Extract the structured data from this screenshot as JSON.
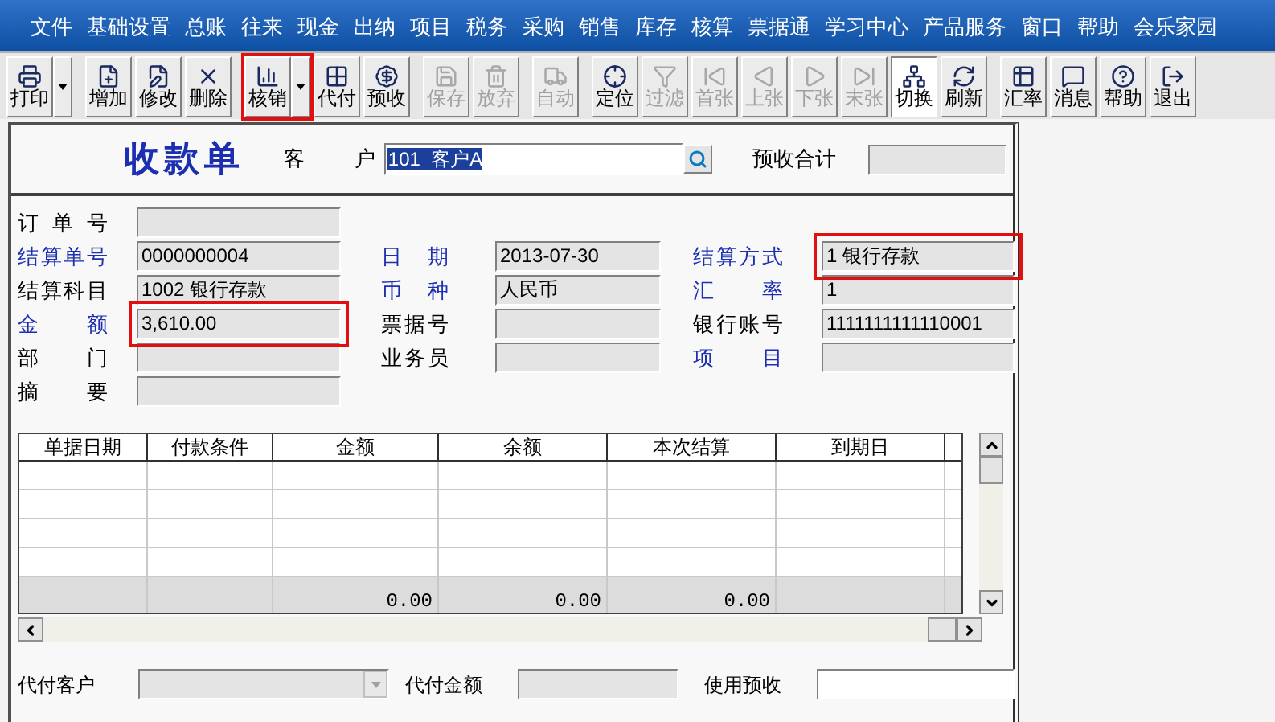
{
  "menu": [
    "文件",
    "基础设置",
    "总账",
    "往来",
    "现金",
    "出纳",
    "项目",
    "税务",
    "采购",
    "销售",
    "库存",
    "核算",
    "票据通",
    "学习中心",
    "产品服务",
    "窗口",
    "帮助",
    "会乐家园"
  ],
  "toolbar": [
    [
      {
        "label": "打印",
        "dropdown": true,
        "disabled": false,
        "pressed": false,
        "highlighted": false
      }
    ],
    [
      {
        "label": "增加",
        "dropdown": false,
        "disabled": false,
        "pressed": false,
        "highlighted": false
      },
      {
        "label": "修改",
        "dropdown": false,
        "disabled": false,
        "pressed": false,
        "highlighted": false
      },
      {
        "label": "删除",
        "dropdown": false,
        "disabled": false,
        "pressed": false,
        "highlighted": false
      }
    ],
    [
      {
        "label": "核销",
        "dropdown": true,
        "disabled": false,
        "pressed": false,
        "highlighted": true
      },
      {
        "label": "代付",
        "dropdown": false,
        "disabled": false,
        "pressed": false,
        "highlighted": false
      },
      {
        "label": "预收",
        "dropdown": false,
        "disabled": false,
        "pressed": false,
        "highlighted": false
      }
    ],
    [
      {
        "label": "保存",
        "dropdown": false,
        "disabled": true,
        "pressed": false,
        "highlighted": false
      },
      {
        "label": "放弃",
        "dropdown": false,
        "disabled": true,
        "pressed": false,
        "highlighted": false
      }
    ],
    [
      {
        "label": "自动",
        "dropdown": false,
        "disabled": true,
        "pressed": false,
        "highlighted": false
      }
    ],
    [
      {
        "label": "定位",
        "dropdown": false,
        "disabled": false,
        "pressed": false,
        "highlighted": false
      },
      {
        "label": "过滤",
        "dropdown": false,
        "disabled": true,
        "pressed": false,
        "highlighted": false
      },
      {
        "label": "首张",
        "dropdown": false,
        "disabled": true,
        "pressed": false,
        "highlighted": false
      },
      {
        "label": "上张",
        "dropdown": false,
        "disabled": true,
        "pressed": false,
        "highlighted": false
      },
      {
        "label": "下张",
        "dropdown": false,
        "disabled": true,
        "pressed": false,
        "highlighted": false
      },
      {
        "label": "末张",
        "dropdown": false,
        "disabled": true,
        "pressed": false,
        "highlighted": false
      },
      {
        "label": "切换",
        "dropdown": false,
        "disabled": false,
        "pressed": true,
        "highlighted": false
      },
      {
        "label": "刷新",
        "dropdown": false,
        "disabled": false,
        "pressed": false,
        "highlighted": false
      }
    ],
    [
      {
        "label": "汇率",
        "dropdown": false,
        "disabled": false,
        "pressed": false,
        "highlighted": false
      },
      {
        "label": "消息",
        "dropdown": false,
        "disabled": false,
        "pressed": false,
        "highlighted": false
      },
      {
        "label": "帮助",
        "dropdown": false,
        "disabled": false,
        "pressed": false,
        "highlighted": false
      },
      {
        "label": "退出",
        "dropdown": false,
        "disabled": false,
        "pressed": false,
        "highlighted": false
      }
    ]
  ],
  "form": {
    "title": "收款单",
    "customer": {
      "label": "客 户",
      "value": "101  客户A"
    },
    "advance_total": {
      "label": "预收合计"
    },
    "rows": [
      [
        {
          "label": "订单号",
          "required": false,
          "highlighted": false
        },
        null,
        null
      ],
      [
        {
          "label": "结算单号",
          "required": true,
          "value": "0000000004",
          "highlighted": false
        },
        {
          "label": "日期",
          "required": true,
          "value": "2013-07-30",
          "highlighted": false
        },
        {
          "label": "结算方式",
          "required": true,
          "value": "1  银行存款",
          "highlighted": true
        }
      ],
      [
        {
          "label": "结算科目",
          "required": false,
          "value": "1002  银行存款",
          "highlighted": false
        },
        {
          "label": "币种",
          "required": true,
          "value": "人民币",
          "highlighted": false
        },
        {
          "label": "汇率",
          "required": true,
          "value": "1",
          "highlighted": false
        }
      ],
      [
        {
          "label": "金额",
          "required": true,
          "value": "3,610.00",
          "highlighted": true
        },
        {
          "label": "票据号",
          "required": false,
          "highlighted": false
        },
        {
          "label": "银行账号",
          "required": false,
          "value": "1111111111110001",
          "highlighted": false
        }
      ],
      [
        {
          "label": "部门",
          "required": false,
          "highlighted": false
        },
        {
          "label": "业务员",
          "required": false,
          "highlighted": false
        },
        {
          "label": "项目",
          "required": true,
          "highlighted": false
        }
      ],
      [
        {
          "label": "摘要",
          "required": false,
          "highlighted": false
        },
        null,
        null
      ]
    ]
  },
  "table": {
    "columns": [
      {
        "label": "单据日期"
      },
      {
        "label": "付款条件"
      },
      {
        "label": "金额",
        "total": "0.00"
      },
      {
        "label": "余额",
        "total": "0.00"
      },
      {
        "label": "本次结算",
        "total": "0.00"
      },
      {
        "label": "到期日"
      }
    ]
  },
  "footer": [
    {
      "label": "代付客户",
      "kind": "combo"
    },
    {
      "label": "代付金额",
      "kind": "disabled"
    },
    {
      "label": "使用预收",
      "kind": "input"
    }
  ]
}
